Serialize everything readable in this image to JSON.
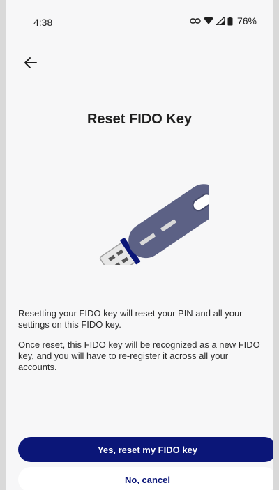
{
  "status_bar": {
    "time": "4:38",
    "battery_percent": "76%",
    "icons": [
      "link-icon",
      "wifi-icon",
      "signal-icon",
      "battery-icon"
    ]
  },
  "header": {
    "back_icon": "arrow-left-icon"
  },
  "main": {
    "title": "Reset FIDO Key",
    "illustration_icon": "usb-security-key-icon",
    "paragraphs": [
      "Resetting your FIDO key will reset your PIN and all your settings on this FIDO key.",
      "Once reset, this FIDO key will be recognized as a new FIDO key, and you will have to re-register it across all your accounts."
    ]
  },
  "actions": {
    "confirm_label": "Yes, reset my FIDO key",
    "cancel_label": "No, cancel"
  },
  "colors": {
    "primary": "#0b1678",
    "key_body": "#5c6185",
    "key_connector": "#9a9a9a",
    "background": "#f7f7f8"
  }
}
